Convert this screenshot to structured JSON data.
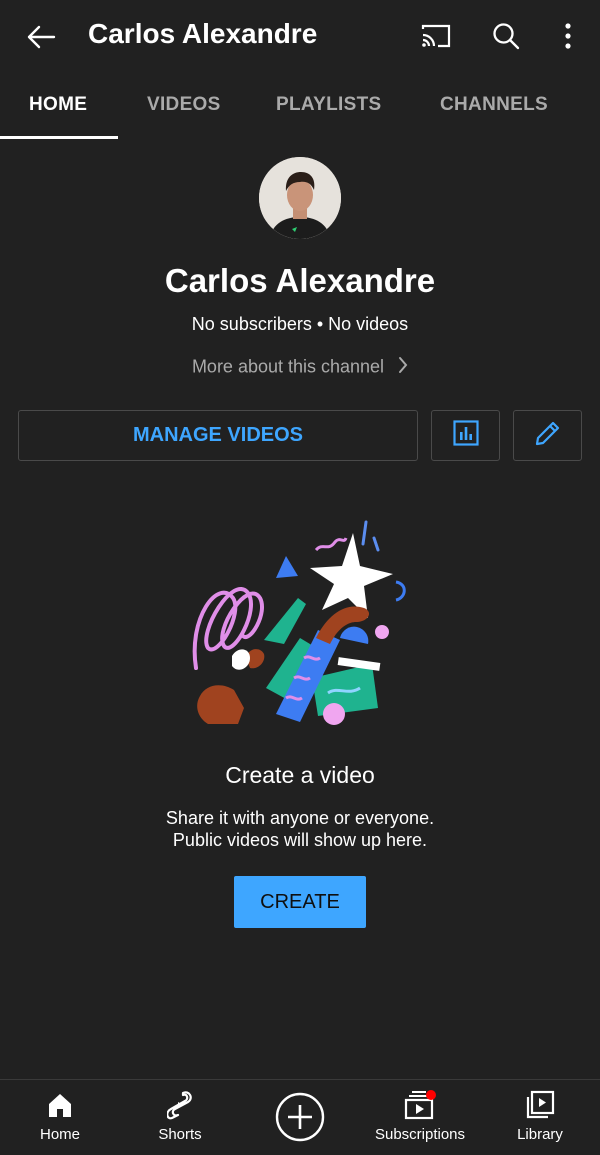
{
  "header": {
    "title": "Carlos Alexandre",
    "icons": [
      "back-arrow-icon",
      "cast-icon",
      "search-icon",
      "more-vert-icon"
    ]
  },
  "tabs": [
    {
      "label": "HOME",
      "active": true
    },
    {
      "label": "VIDEOS",
      "active": false
    },
    {
      "label": "PLAYLISTS",
      "active": false
    },
    {
      "label": "CHANNELS",
      "active": false
    }
  ],
  "channel": {
    "name": "Carlos Alexandre",
    "stats": "No subscribers • No videos",
    "more_about": "More about this channel"
  },
  "actions": {
    "manage_videos": "MANAGE VIDEOS",
    "analytics_icon": "bar-chart-icon",
    "edit_icon": "pencil-icon"
  },
  "empty_state": {
    "title": "Create a video",
    "line1": "Share it with anyone or everyone.",
    "line2": "Public videos will show up here.",
    "button": "CREATE"
  },
  "bottom_nav": [
    {
      "label": "Home",
      "icon": "home-icon"
    },
    {
      "label": "Shorts",
      "icon": "shorts-icon"
    },
    {
      "label": "",
      "icon": "create-plus-icon"
    },
    {
      "label": "Subscriptions",
      "icon": "subscriptions-icon",
      "badge": true
    },
    {
      "label": "Library",
      "icon": "library-icon"
    }
  ],
  "colors": {
    "background": "#212121",
    "accent": "#3ea6ff",
    "secondary_text": "#aaaaaa",
    "badge": "#ff0000"
  }
}
